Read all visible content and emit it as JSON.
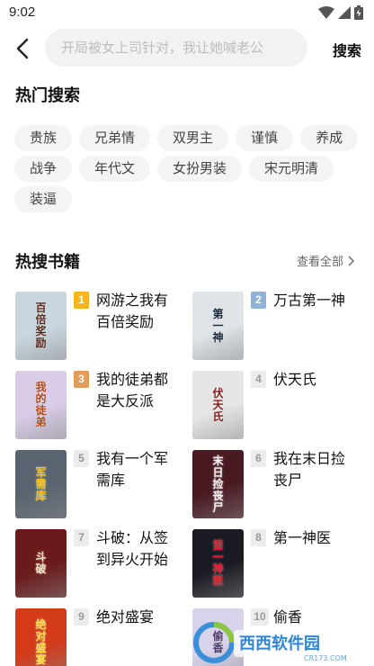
{
  "status": {
    "time": "9:02"
  },
  "search": {
    "placeholder": "开局被女上司针对，我让她喊老公",
    "button_label": "搜索"
  },
  "hot_search": {
    "title": "热门搜索",
    "tags": [
      "贵族",
      "兄弟情",
      "双男主",
      "谨慎",
      "养成",
      "战争",
      "年代文",
      "女扮男装",
      "宋元明清",
      "装逼"
    ]
  },
  "hot_books": {
    "title": "热搜书籍",
    "view_all_label": "查看全部",
    "items": [
      {
        "rank": "1",
        "title": "网游之我有百倍奖励",
        "cover_text": "百倍奖励",
        "cover_bg": "#c9d6df",
        "cover_fg": "#5a2a1a"
      },
      {
        "rank": "2",
        "title": "万古第一神",
        "cover_text": "第一神",
        "cover_bg": "#dfe4e8",
        "cover_fg": "#1a2a3a"
      },
      {
        "rank": "3",
        "title": "我的徒弟都是大反派",
        "cover_text": "我的徒弟",
        "cover_bg": "#d8cce6",
        "cover_fg": "#b24a1a"
      },
      {
        "rank": "4",
        "title": "伏天氏",
        "cover_text": "伏天氏",
        "cover_bg": "#e6e6e6",
        "cover_fg": "#8a1a1a"
      },
      {
        "rank": "5",
        "title": "我有一个军需库",
        "cover_text": "军需库",
        "cover_bg": "#5a6470",
        "cover_fg": "#f0c020"
      },
      {
        "rank": "6",
        "title": "我在末日捡丧尸",
        "cover_text": "末日捡丧尸",
        "cover_bg": "#4a1a22",
        "cover_fg": "#f4f4f4"
      },
      {
        "rank": "7",
        "title": "斗破：从签到异火开始",
        "cover_text": "斗破",
        "cover_bg": "#6a1a1a",
        "cover_fg": "#f2e2c2"
      },
      {
        "rank": "8",
        "title": "第一神医",
        "cover_text": "第一神医",
        "cover_bg": "#1a1a22",
        "cover_fg": "#e21a2a"
      },
      {
        "rank": "9",
        "title": "绝对盛宴",
        "cover_text": "绝对盛宴",
        "cover_bg": "#d23a1a",
        "cover_fg": "#ffe24a"
      },
      {
        "rank": "10",
        "title": "偷香",
        "cover_text": "偷香",
        "cover_bg": "#d8d2ea",
        "cover_fg": "#4a3a6a"
      }
    ]
  },
  "watermark": {
    "name": "西西软件园",
    "site": "CR173.COM"
  },
  "colors": {
    "rank1": "#f6b619",
    "rank2": "#8fb2d6",
    "rank3": "#e39b58",
    "tag_bg": "#f4f4f4",
    "search_bg": "#f2f2f2"
  },
  "icons": {
    "back": "chevron-left-icon",
    "view_all": "chevron-right-icon",
    "wifi": "wifi-icon",
    "signal": "signal-icon",
    "battery": "battery-icon"
  }
}
